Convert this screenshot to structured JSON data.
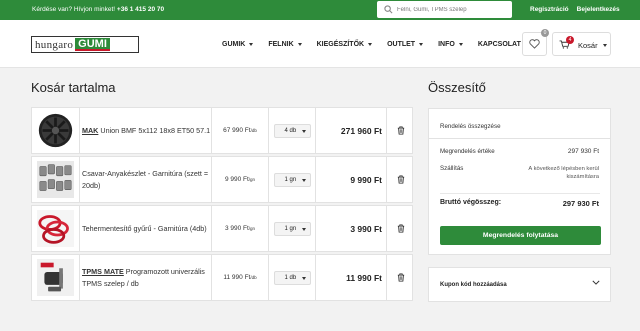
{
  "topbar": {
    "question": "Kérdése van? Hívjon minket!",
    "phone": "+36 1 415 20 70",
    "search_placeholder": "Felni, Gumi, TPMS szelep",
    "register": "Regisztráció",
    "login": "Bejelentkezés"
  },
  "logo": {
    "part1": "hungaro",
    "part2": "GUMI"
  },
  "nav": [
    {
      "label": "GUMIK",
      "has_dropdown": true
    },
    {
      "label": "FELNIK",
      "has_dropdown": true
    },
    {
      "label": "KIEGÉSZÍTŐK",
      "has_dropdown": true
    },
    {
      "label": "OUTLET",
      "has_dropdown": true
    },
    {
      "label": "INFO",
      "has_dropdown": true
    },
    {
      "label": "KAPCSOLAT",
      "has_dropdown": false
    }
  ],
  "wishlist": {
    "count": "0"
  },
  "cart": {
    "label": "Kosár",
    "count": "4"
  },
  "cart_title": "Kosár tartalma",
  "items": [
    {
      "brand": "MAK",
      "name": "Union BMF 5x112 18x8 ET50 57.1",
      "price": "67 990 Ft",
      "unit": "/db",
      "qty": "4 db",
      "total": "271 960 Ft",
      "thumb": "wheel-rim"
    },
    {
      "brand": "",
      "name": "Csavar-Anyakészlet - Garnitúra (szett = 20db)",
      "price": "9 990 Ft",
      "unit": "/gn",
      "qty": "1 gn",
      "total": "9 990 Ft",
      "thumb": "bolt-set"
    },
    {
      "brand": "",
      "name": "Tehermentesítő gyűrű - Garnitúra (4db)",
      "price": "3 990 Ft",
      "unit": "/gn",
      "qty": "1 gn",
      "total": "3 990 Ft",
      "thumb": "centering-rings"
    },
    {
      "brand": "TPMS MATE",
      "name": "Programozott univerzális TPMS szelep / db",
      "price": "11 990 Ft",
      "unit": "/db",
      "qty": "1 db",
      "total": "11 990 Ft",
      "thumb": "tpms-sensor"
    }
  ],
  "summary": {
    "title": "Összesítő",
    "section": "Rendelés összegzése",
    "order_value_label": "Megrendelés értéke",
    "order_value": "297 930 Ft",
    "shipping_label": "Szállítás",
    "shipping_value": "A következő lépésben kerül kiszámításra",
    "gross_label": "Bruttó végösszeg:",
    "gross_value": "297 930 Ft",
    "checkout_label": "Megrendelés folytatása"
  },
  "coupon": {
    "label": "Kupon kód hozzáadása"
  },
  "colors": {
    "brand_green": "#2e8b3a",
    "accent_red": "#c9182b"
  }
}
